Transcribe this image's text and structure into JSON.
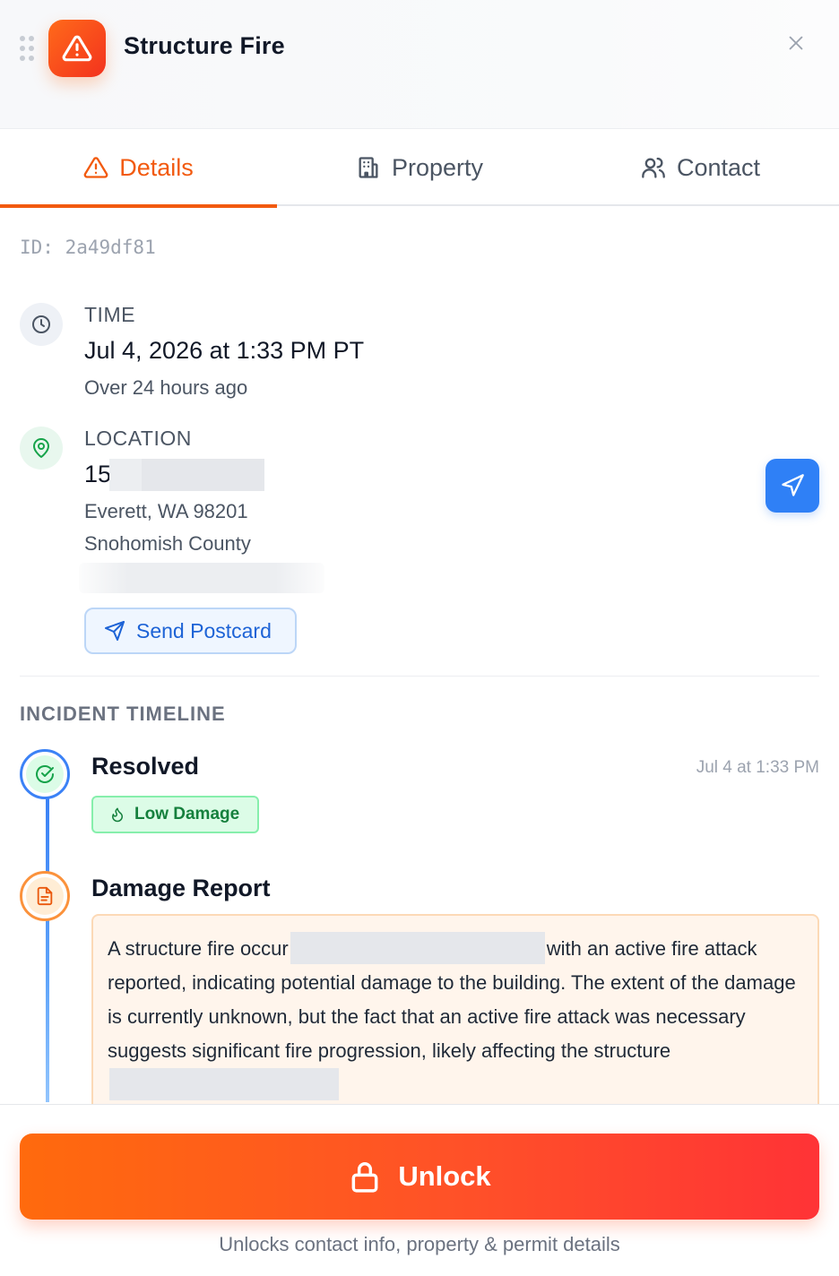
{
  "header": {
    "title": "Structure Fire",
    "icons": {
      "drag": "drag-handle-icon",
      "app": "warning-triangle-icon",
      "close": "close-icon"
    }
  },
  "tabs": [
    {
      "label": "Details",
      "icon": "warning-triangle-icon",
      "active": true
    },
    {
      "label": "Property",
      "icon": "building-icon",
      "active": false
    },
    {
      "label": "Contact",
      "icon": "users-icon",
      "active": false
    }
  ],
  "details": {
    "id_text": "ID: 2a49df81",
    "time": {
      "label": "TIME",
      "value": "Jul 4, 2026 at 1:33 PM PT",
      "relative": "Over 24 hours ago"
    },
    "location": {
      "label": "LOCATION",
      "street_prefix": "15",
      "city_line": "Everett, WA 98201",
      "county": "Snohomish County"
    },
    "send_postcard_label": "Send Postcard"
  },
  "timeline": {
    "section_title": "INCIDENT TIMELINE",
    "events": [
      {
        "title": "Resolved",
        "time": "Jul 4 at 1:33 PM",
        "badge": "Low Damage"
      },
      {
        "title": "Damage Report",
        "text_1": "A structure fire occur",
        "text_2": "with an active fire attack reported, indicating potential damage to the building. The extent of the damage is currently unknown, but the fact that an active fire attack was necessary suggests significant fire progression, likely affecting the structure"
      }
    ]
  },
  "footer": {
    "unlock_label": "Unlock",
    "hint": "Unlocks contact info, property & permit details"
  },
  "colors": {
    "accent": "#f25a0f",
    "primary_blue": "#2f80f6",
    "success_green": "#15803d",
    "unlock_gradient_start": "#ff6a0d",
    "unlock_gradient_end": "#ff3336"
  }
}
